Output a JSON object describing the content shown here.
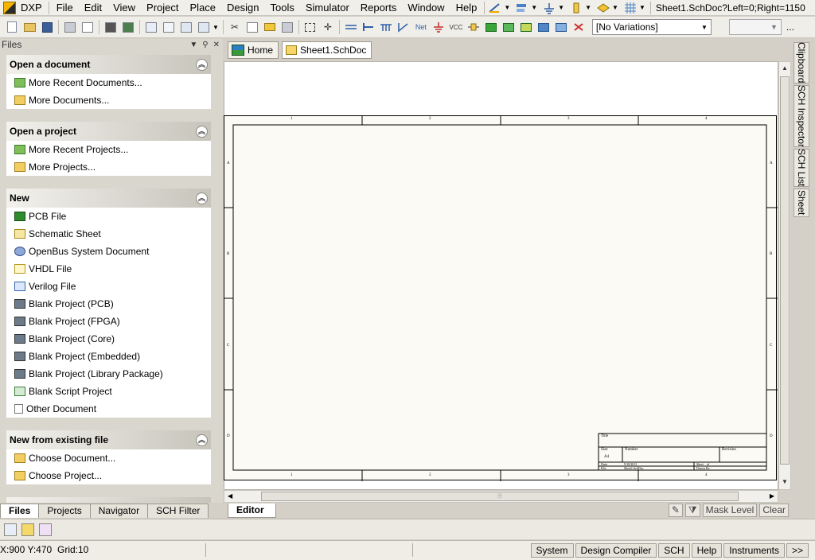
{
  "menubar": {
    "dxp_label": "DXP",
    "items": [
      "File",
      "Edit",
      "View",
      "Project",
      "Place",
      "Design",
      "Tools",
      "Simulator",
      "Reports",
      "Window",
      "Help"
    ],
    "document_path": "Sheet1.SchDoc?Left=0;Right=1150"
  },
  "toolbar": {
    "variations_value": "[No Variations]",
    "overflow_label": "..."
  },
  "panel": {
    "title": "Files",
    "sections": [
      {
        "title": "Open a document",
        "items": [
          {
            "label": "More Recent Documents...",
            "icon": "folder-green-icon"
          },
          {
            "label": "More Documents...",
            "icon": "folder-open-icon"
          }
        ]
      },
      {
        "title": "Open a project",
        "items": [
          {
            "label": "More Recent Projects...",
            "icon": "folder-green-icon"
          },
          {
            "label": "More Projects...",
            "icon": "folder-open-icon"
          }
        ]
      },
      {
        "title": "New",
        "items": [
          {
            "label": "PCB File",
            "icon": "pcb-icon"
          },
          {
            "label": "Schematic Sheet",
            "icon": "schematic-icon"
          },
          {
            "label": "OpenBus System Document",
            "icon": "openbus-icon"
          },
          {
            "label": "VHDL File",
            "icon": "vhdl-icon"
          },
          {
            "label": "Verilog File",
            "icon": "verilog-icon"
          },
          {
            "label": "Blank Project (PCB)",
            "icon": "project-pcb-icon"
          },
          {
            "label": "Blank Project (FPGA)",
            "icon": "project-fpga-icon"
          },
          {
            "label": "Blank Project (Core)",
            "icon": "project-core-icon"
          },
          {
            "label": "Blank Project (Embedded)",
            "icon": "project-embedded-icon"
          },
          {
            "label": "Blank Project (Library Package)",
            "icon": "project-library-icon"
          },
          {
            "label": "Blank Script Project",
            "icon": "script-icon"
          },
          {
            "label": "Other Document",
            "icon": "blank-document-icon"
          }
        ]
      },
      {
        "title": "New from existing file",
        "items": [
          {
            "label": "Choose Document...",
            "icon": "folder-open-icon"
          },
          {
            "label": "Choose Project...",
            "icon": "folder-open-icon"
          }
        ]
      }
    ],
    "tabs": [
      "Files",
      "Projects",
      "Navigator",
      "SCH Filter"
    ],
    "active_tab": "Files"
  },
  "doc_tabs": [
    "Home",
    "Sheet1.SchDoc"
  ],
  "right_tabs": [
    "Clipboard",
    "SCH Inspector",
    "SCH List",
    "Sheet"
  ],
  "editor": {
    "tab_label": "Editor",
    "mask_level_label": "Mask Level",
    "clear_label": "Clear"
  },
  "sheet": {
    "zone_numbers_top": [
      "1",
      "2",
      "3",
      "4"
    ],
    "zone_letters_side": [
      "A",
      "B",
      "C",
      "D"
    ],
    "title_block": {
      "title_label": "Title",
      "size_label": "Size",
      "size_value": "A4",
      "number_label": "Number",
      "revision_label": "Revision",
      "date_label": "Date:",
      "date_value": "9/10/2013",
      "sheet_label": "Sheet    of",
      "file_label": "File:",
      "file_value": "Sheet1.SchDoc",
      "drawn_by_label": "Drawn By:"
    }
  },
  "statusbar": {
    "coordinates": "X:900 Y:470",
    "grid": "Grid:10",
    "buttons": [
      "System",
      "Design Compiler",
      "SCH",
      "Help",
      "Instruments",
      ">>"
    ]
  },
  "colors": {
    "accent_menu": "#f0efe9",
    "sheet_bg": "#fcfaf4",
    "panel_bg": "#d9d6ce"
  }
}
